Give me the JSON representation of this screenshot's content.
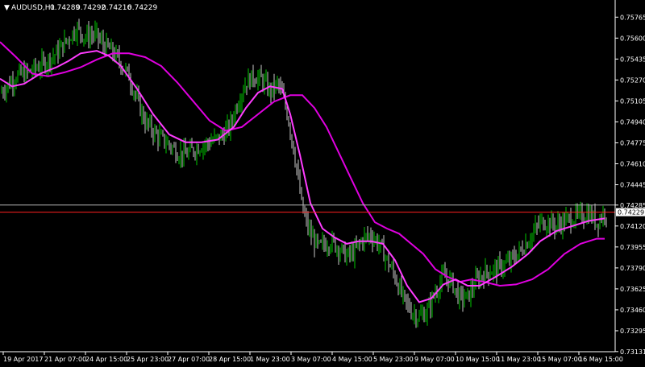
{
  "header": {
    "menu_glyph": "▼",
    "symbol_label": "AUDUSD,H1",
    "ohlc": [
      "0.74289",
      "0.74292",
      "0.74216",
      "0.74229"
    ]
  },
  "colors": {
    "background": "#000000",
    "frame": "#ffffff",
    "bull_bar": "#00c800",
    "bear_bar": "#c8c8c8",
    "ma_fast": "#ff3cff",
    "ma_slow": "#e000e0",
    "bid_line": "#ff2020",
    "ask_line": "#b8b8b8"
  },
  "chart_data": {
    "type": "ohlc-bars",
    "symbol": "AUDUSD",
    "timeframe": "H1",
    "ylim": [
      0.7313,
      0.759
    ],
    "current_price": "0.74229",
    "last_price_tag": "0.74285",
    "y_ticks": [
      "0.75765",
      "0.75600",
      "0.75435",
      "0.75270",
      "0.75105",
      "0.74940",
      "0.74775",
      "0.74610",
      "0.74445",
      "0.74285",
      "0.74120",
      "0.73955",
      "0.73790",
      "0.73625",
      "0.73460",
      "0.73295",
      "0.73131"
    ],
    "x_ticks": [
      "19 Apr 2017",
      "21 Apr 07:00",
      "24 Apr 15:00",
      "25 Apr 23:00",
      "27 Apr 07:00",
      "28 Apr 15:00",
      "1 May 23:00",
      "3 May 07:00",
      "4 May 15:00",
      "5 May 23:00",
      "9 May 07:00",
      "10 May 15:00",
      "11 May 23:00",
      "15 May 07:00",
      "16 May 15:00"
    ],
    "price_path": [
      [
        0,
        0.7517,
        "19 Apr 2017"
      ],
      [
        10,
        0.7523
      ],
      [
        20,
        0.753
      ],
      [
        35,
        0.7533
      ],
      [
        55,
        0.754
      ],
      [
        70,
        0.7548
      ],
      [
        85,
        0.756
      ],
      [
        95,
        0.7568
      ],
      [
        105,
        0.7561
      ],
      [
        118,
        0.7563
      ],
      [
        128,
        0.7555
      ],
      [
        138,
        0.755
      ],
      [
        150,
        0.754
      ],
      [
        160,
        0.753
      ],
      [
        168,
        0.7515
      ],
      [
        180,
        0.7494
      ],
      [
        195,
        0.7483
      ],
      [
        210,
        0.7476
      ],
      [
        220,
        0.747
      ],
      [
        230,
        0.7468
      ],
      [
        245,
        0.7474
      ],
      [
        260,
        0.7478
      ],
      [
        275,
        0.7483
      ],
      [
        285,
        0.749
      ],
      [
        295,
        0.751
      ],
      [
        305,
        0.7525
      ],
      [
        315,
        0.753
      ],
      [
        325,
        0.7527
      ],
      [
        335,
        0.7518
      ],
      [
        345,
        0.7524
      ],
      [
        355,
        0.7505
      ],
      [
        365,
        0.747
      ],
      [
        375,
        0.7425
      ],
      [
        385,
        0.7405
      ],
      [
        395,
        0.7395
      ],
      [
        410,
        0.74
      ],
      [
        420,
        0.7395
      ],
      [
        430,
        0.7388
      ],
      [
        440,
        0.7392
      ],
      [
        450,
        0.7402
      ],
      [
        460,
        0.7405
      ],
      [
        470,
        0.7398
      ],
      [
        480,
        0.7385
      ],
      [
        490,
        0.7372
      ],
      [
        500,
        0.7355
      ],
      [
        510,
        0.7345
      ],
      [
        520,
        0.734
      ],
      [
        530,
        0.7345
      ],
      [
        540,
        0.736
      ],
      [
        550,
        0.7372
      ],
      [
        560,
        0.7368
      ],
      [
        570,
        0.7355
      ],
      [
        580,
        0.7356
      ],
      [
        590,
        0.7368
      ],
      [
        600,
        0.7375
      ],
      [
        615,
        0.7378
      ],
      [
        630,
        0.7383
      ],
      [
        645,
        0.7392
      ],
      [
        660,
        0.7405
      ],
      [
        670,
        0.7415
      ],
      [
        680,
        0.7415
      ],
      [
        690,
        0.7412
      ],
      [
        700,
        0.7416
      ],
      [
        710,
        0.7418
      ],
      [
        720,
        0.742
      ],
      [
        730,
        0.7422
      ],
      [
        740,
        0.7415
      ],
      [
        750,
        0.7423
      ]
    ],
    "ma_fast": [
      [
        0,
        0.7528
      ],
      [
        15,
        0.7522
      ],
      [
        30,
        0.7524
      ],
      [
        50,
        0.7532
      ],
      [
        70,
        0.7537
      ],
      [
        85,
        0.7542
      ],
      [
        100,
        0.7548
      ],
      [
        120,
        0.755
      ],
      [
        135,
        0.7546
      ],
      [
        150,
        0.7538
      ],
      [
        170,
        0.752
      ],
      [
        190,
        0.75
      ],
      [
        210,
        0.7484
      ],
      [
        230,
        0.7478
      ],
      [
        250,
        0.7478
      ],
      [
        270,
        0.748
      ],
      [
        290,
        0.749
      ],
      [
        305,
        0.7505
      ],
      [
        320,
        0.7517
      ],
      [
        335,
        0.7522
      ],
      [
        350,
        0.752
      ],
      [
        360,
        0.75
      ],
      [
        372,
        0.7468
      ],
      [
        385,
        0.743
      ],
      [
        400,
        0.741
      ],
      [
        415,
        0.7403
      ],
      [
        430,
        0.7398
      ],
      [
        445,
        0.74
      ],
      [
        460,
        0.74
      ],
      [
        475,
        0.7398
      ],
      [
        490,
        0.7385
      ],
      [
        505,
        0.7365
      ],
      [
        520,
        0.7352
      ],
      [
        535,
        0.7355
      ],
      [
        550,
        0.7366
      ],
      [
        565,
        0.737
      ],
      [
        580,
        0.7365
      ],
      [
        595,
        0.7365
      ],
      [
        615,
        0.7372
      ],
      [
        635,
        0.738
      ],
      [
        655,
        0.739
      ],
      [
        670,
        0.74
      ],
      [
        690,
        0.7408
      ],
      [
        710,
        0.7412
      ],
      [
        730,
        0.7416
      ],
      [
        750,
        0.7418
      ]
    ],
    "ma_slow": [
      [
        0,
        0.7557
      ],
      [
        20,
        0.7545
      ],
      [
        40,
        0.7532
      ],
      [
        60,
        0.753
      ],
      [
        80,
        0.7533
      ],
      [
        100,
        0.7537
      ],
      [
        120,
        0.7543
      ],
      [
        140,
        0.7548
      ],
      [
        160,
        0.7548
      ],
      [
        180,
        0.7545
      ],
      [
        200,
        0.7538
      ],
      [
        220,
        0.7525
      ],
      [
        240,
        0.751
      ],
      [
        260,
        0.7495
      ],
      [
        280,
        0.7487
      ],
      [
        300,
        0.749
      ],
      [
        320,
        0.75
      ],
      [
        340,
        0.751
      ],
      [
        360,
        0.7515
      ],
      [
        375,
        0.7515
      ],
      [
        390,
        0.7505
      ],
      [
        405,
        0.749
      ],
      [
        420,
        0.747
      ],
      [
        435,
        0.745
      ],
      [
        450,
        0.743
      ],
      [
        465,
        0.7415
      ],
      [
        480,
        0.741
      ],
      [
        495,
        0.7406
      ],
      [
        510,
        0.7398
      ],
      [
        525,
        0.739
      ],
      [
        540,
        0.7378
      ],
      [
        555,
        0.7372
      ],
      [
        570,
        0.7368
      ],
      [
        585,
        0.737
      ],
      [
        600,
        0.7368
      ],
      [
        620,
        0.7365
      ],
      [
        640,
        0.7366
      ],
      [
        660,
        0.737
      ],
      [
        680,
        0.7378
      ],
      [
        700,
        0.739
      ],
      [
        720,
        0.7398
      ],
      [
        740,
        0.7402
      ],
      [
        750,
        0.7402
      ]
    ]
  }
}
